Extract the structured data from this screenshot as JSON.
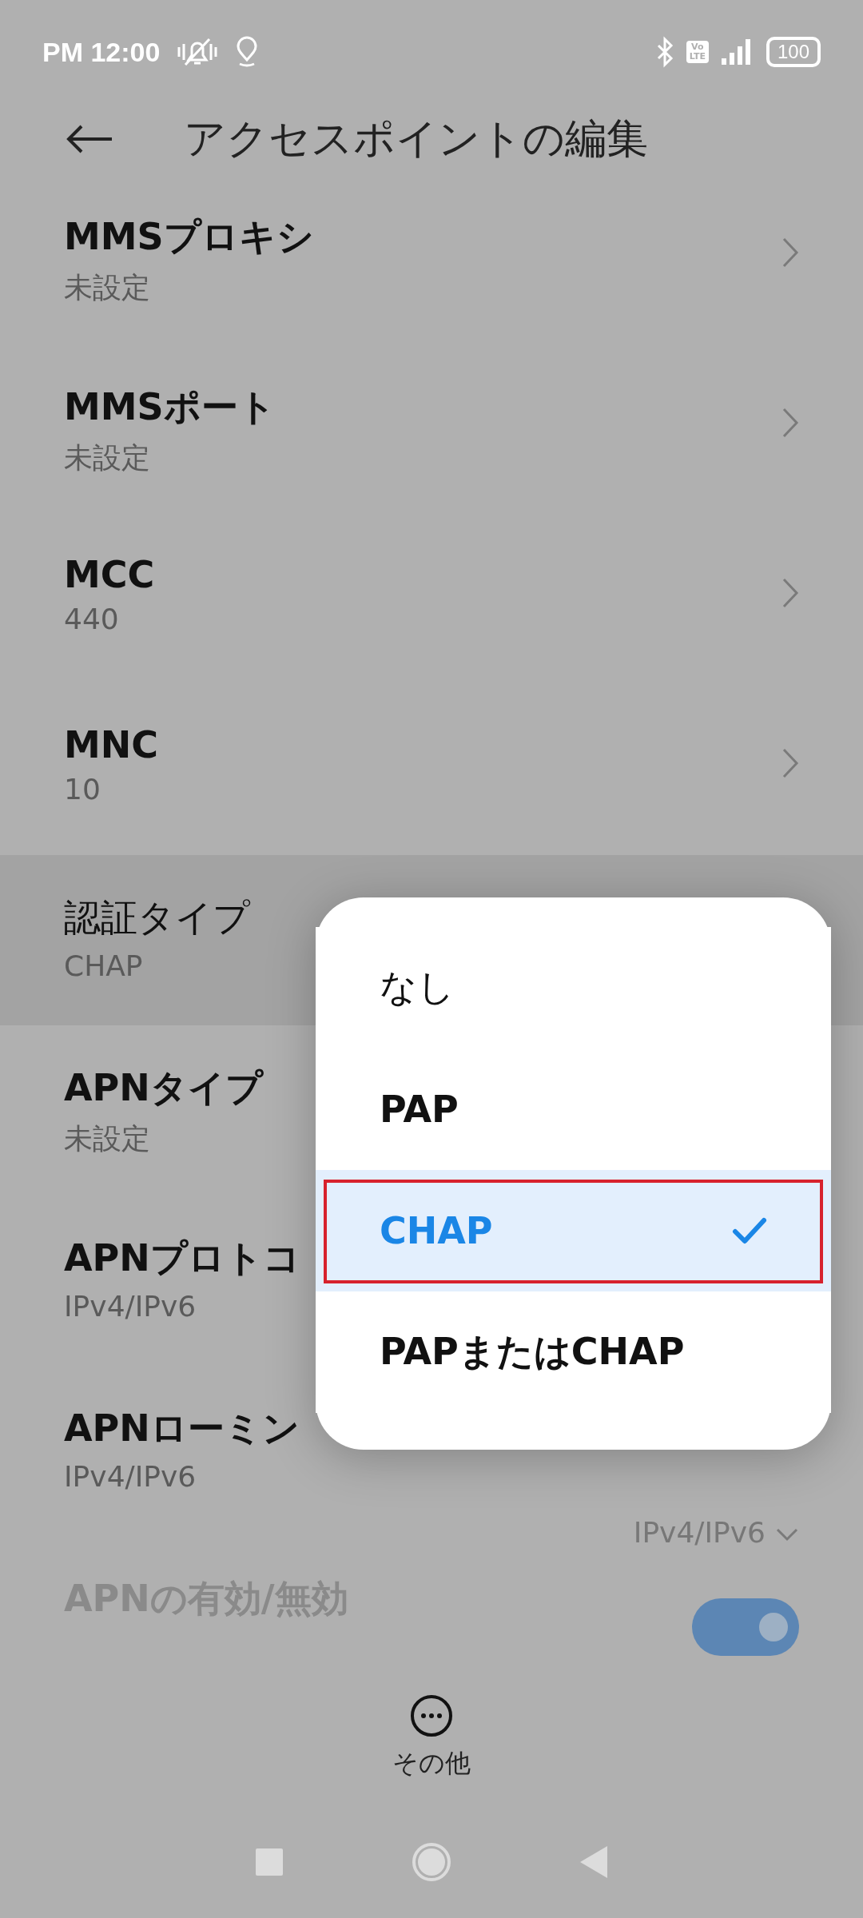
{
  "status_bar": {
    "time": "PM 12:00",
    "volte": [
      "Vo",
      "LTE"
    ],
    "battery": "100"
  },
  "header": {
    "title": "アクセスポイントの編集"
  },
  "settings": [
    {
      "kind": "link",
      "title": "MMSプロキシ",
      "value": "未設定",
      "highlighted": false
    },
    {
      "kind": "link",
      "title": "MMSポート",
      "value": "未設定",
      "highlighted": false
    },
    {
      "kind": "link",
      "title": "MCC",
      "value": "440",
      "highlighted": false
    },
    {
      "kind": "link",
      "title": "MNC",
      "value": "10",
      "highlighted": false
    },
    {
      "kind": "plain",
      "title": "認証タイプ",
      "value": "CHAP",
      "highlighted": true
    },
    {
      "kind": "plain",
      "title": "APNタイプ",
      "value": "未設定",
      "highlighted": false
    },
    {
      "kind": "plain",
      "title": "APNプロトコ",
      "value": "IPv4/IPv6",
      "highlighted": false
    },
    {
      "kind": "dropdown",
      "title": "APNローミン",
      "value": "IPv4/IPv6",
      "current": "IPv4/IPv6",
      "highlighted": false
    },
    {
      "kind": "toggle",
      "title": "APNの有効/無効",
      "on": true,
      "disabled": true,
      "highlighted": false
    }
  ],
  "popup": {
    "options": [
      {
        "label": "なし",
        "selected": false,
        "outlined": false
      },
      {
        "label": "PAP",
        "selected": false,
        "outlined": false
      },
      {
        "label": "CHAP",
        "selected": true,
        "outlined": true
      },
      {
        "label": "PAPまたはCHAP",
        "selected": false,
        "outlined": false
      }
    ]
  },
  "bottom_action": {
    "label": "その他"
  }
}
